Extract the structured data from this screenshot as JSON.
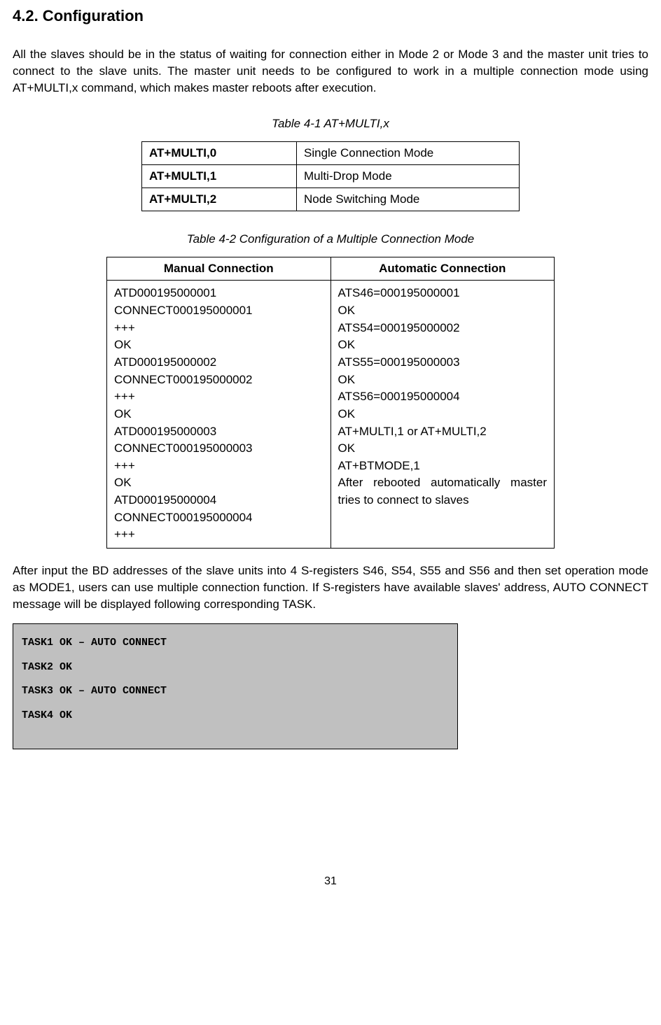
{
  "heading": "4.2. Configuration",
  "para1": "All the slaves should be in the status of waiting for connection either in Mode 2 or Mode 3 and the master unit tries to connect to the slave units. The master unit needs to be configured to work in a multiple connection mode using AT+MULTI,x command, which makes master reboots after execution.",
  "table1": {
    "caption": "Table 4-1 AT+MULTI,x",
    "rows": [
      {
        "cmd": "AT+MULTI,0",
        "desc": "Single Connection Mode"
      },
      {
        "cmd": "AT+MULTI,1",
        "desc": "Multi-Drop Mode"
      },
      {
        "cmd": "AT+MULTI,2",
        "desc": "Node Switching Mode"
      }
    ]
  },
  "table2": {
    "caption": "Table 4-2 Configuration of a Multiple Connection Mode",
    "headers": {
      "h1": "Manual Connection",
      "h2": "Automatic Connection"
    },
    "manual": "ATD000195000001\nCONNECT000195000001\n+++\nOK\nATD000195000002\nCONNECT000195000002\n+++\nOK\nATD000195000003\nCONNECT000195000003\n+++\nOK\nATD000195000004\nCONNECT000195000004\n+++",
    "auto": "ATS46=000195000001\nOK\nATS54=000195000002\nOK\nATS55=000195000003\nOK\nATS56=000195000004\nOK\nAT+MULTI,1 or AT+MULTI,2\nOK\nAT+BTMODE,1",
    "auto_last": "After rebooted automatically master tries to connect to slaves"
  },
  "para2": "After input the BD addresses of the slave units into 4 S-registers S46, S54, S55 and S56 and then set operation mode as MODE1, users can use multiple connection function. If S-registers have available slaves' address, AUTO CONNECT message will be displayed following corresponding TASK.",
  "codebox": "TASK1 OK – AUTO CONNECT\nTASK2 OK\nTASK3 OK – AUTO CONNECT\nTASK4 OK",
  "pagenum": "31"
}
